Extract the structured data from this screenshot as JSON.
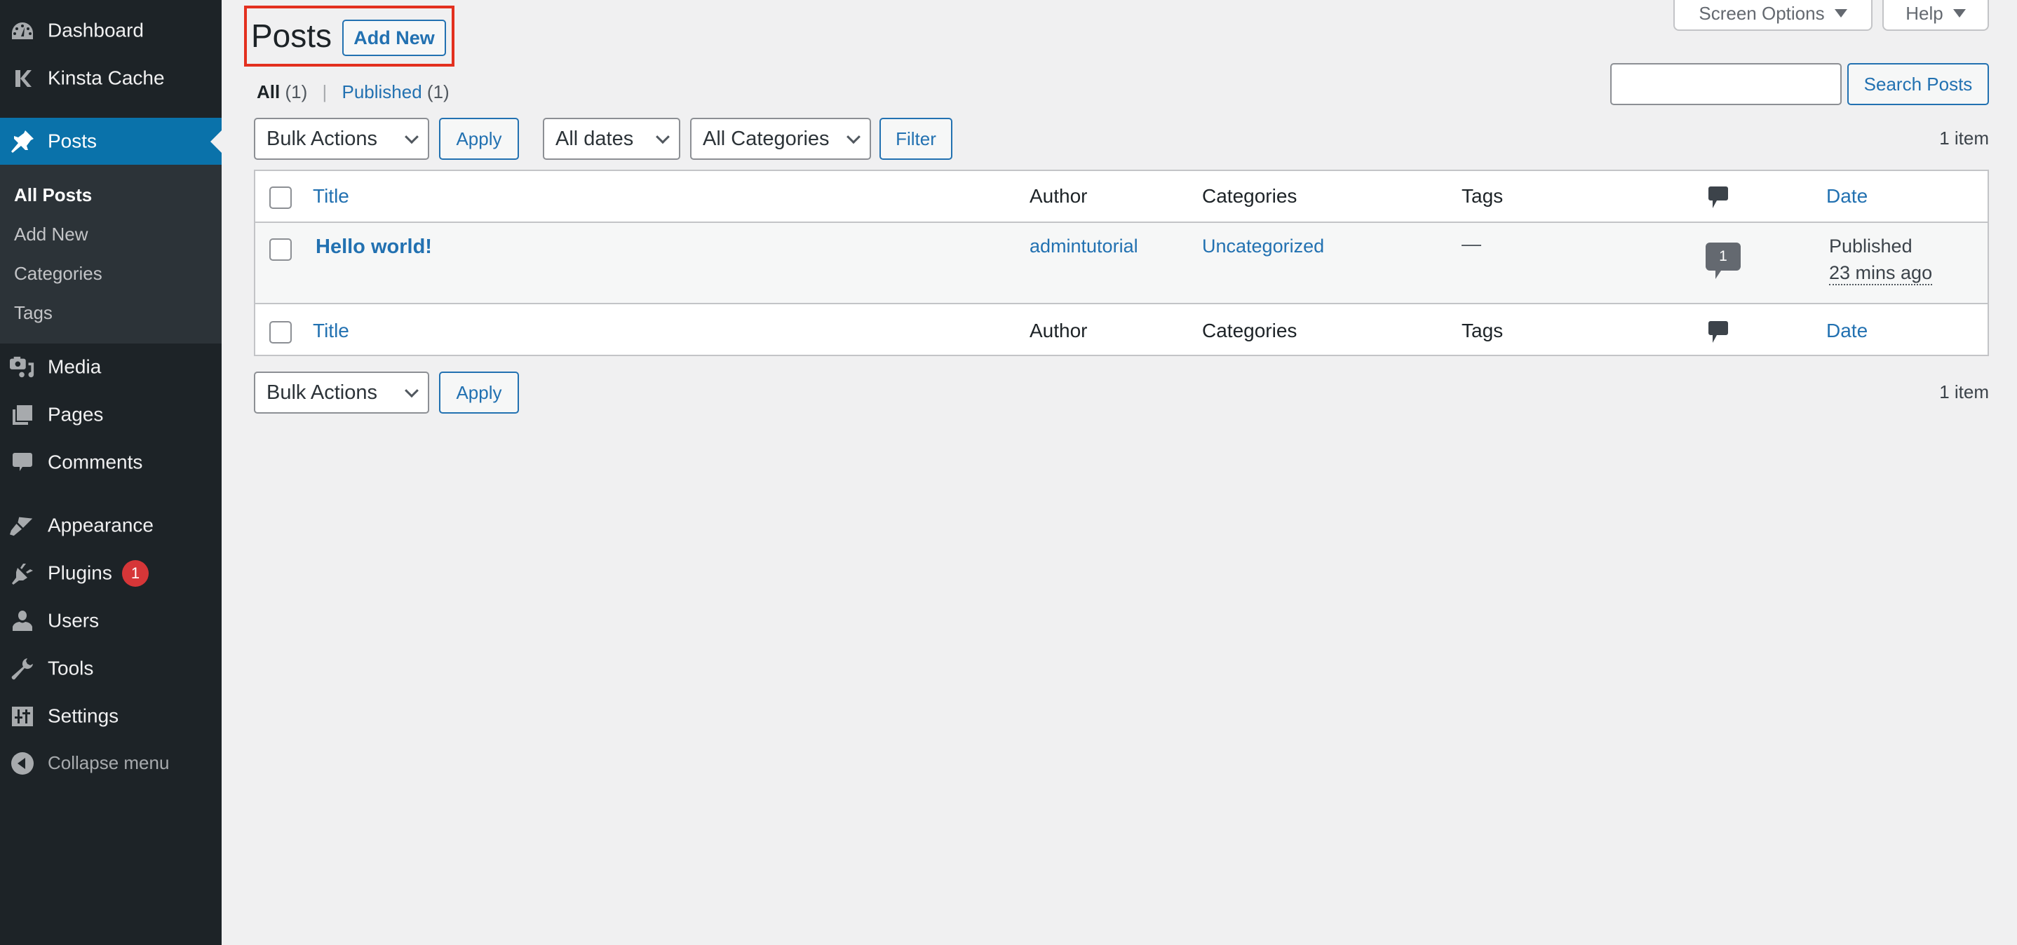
{
  "sidebar": {
    "items": [
      {
        "label": "Dashboard",
        "icon": "dashboard-icon"
      },
      {
        "label": "Kinsta Cache",
        "icon": "kinsta-k-icon"
      },
      {
        "label": "Posts",
        "icon": "pushpin-icon",
        "current": true
      },
      {
        "label": "Media",
        "icon": "media-icon"
      },
      {
        "label": "Pages",
        "icon": "pages-icon"
      },
      {
        "label": "Comments",
        "icon": "comment-icon"
      },
      {
        "label": "Appearance",
        "icon": "paintbrush-icon"
      },
      {
        "label": "Plugins",
        "icon": "plugin-icon",
        "badge": "1"
      },
      {
        "label": "Users",
        "icon": "user-icon"
      },
      {
        "label": "Tools",
        "icon": "wrench-icon"
      },
      {
        "label": "Settings",
        "icon": "settings-sliders-icon"
      }
    ],
    "submenu": [
      {
        "label": "All Posts",
        "current": true
      },
      {
        "label": "Add New"
      },
      {
        "label": "Categories"
      },
      {
        "label": "Tags"
      }
    ],
    "collapse_label": "Collapse menu"
  },
  "top_tabs": {
    "screen_options": "Screen Options",
    "help": "Help"
  },
  "heading": {
    "title": "Posts",
    "add_new": "Add New",
    "highlight_color": "#e3301f"
  },
  "views": {
    "all_label": "All",
    "all_count": "(1)",
    "separator": "|",
    "published_label": "Published",
    "published_count": "(1)"
  },
  "search": {
    "value": "",
    "button": "Search Posts"
  },
  "tablenav_top": {
    "bulk_actions": "Bulk Actions",
    "apply": "Apply",
    "dates": "All dates",
    "categories": "All Categories",
    "filter": "Filter",
    "count": "1 item"
  },
  "table": {
    "columns": {
      "title": "Title",
      "author": "Author",
      "categories": "Categories",
      "tags": "Tags",
      "comments_icon": "comment-bubble-icon",
      "date": "Date"
    },
    "rows": [
      {
        "title": "Hello world!",
        "author": "admintutorial",
        "categories": "Uncategorized",
        "tags": "—",
        "comments": "1",
        "date_status": "Published",
        "date_value": "23 mins ago"
      }
    ]
  },
  "tablenav_bottom": {
    "bulk_actions": "Bulk Actions",
    "apply": "Apply",
    "count": "1 item"
  },
  "colors": {
    "sidebar_bg": "#1d2327",
    "active_menu": "#0a72aa",
    "link": "#2271b1",
    "badge": "#d63638"
  }
}
